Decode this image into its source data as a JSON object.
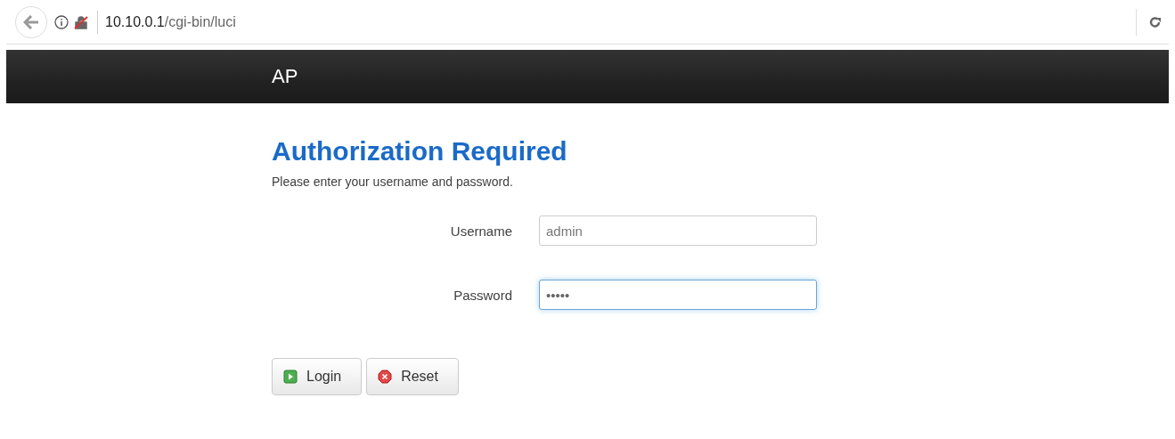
{
  "browser": {
    "url_host": "10.10.0.1",
    "url_path": "/cgi-bin/luci"
  },
  "header": {
    "title": "AP"
  },
  "page": {
    "title": "Authorization Required",
    "subtitle": "Please enter your username and password."
  },
  "fields": [
    {
      "label": "Username",
      "value": "admin",
      "focused": false
    },
    {
      "label": "Password",
      "value": "•••••",
      "focused": true
    }
  ],
  "buttons": [
    {
      "label": "Login",
      "kind": "apply"
    },
    {
      "label": "Reset",
      "kind": "reset"
    }
  ]
}
